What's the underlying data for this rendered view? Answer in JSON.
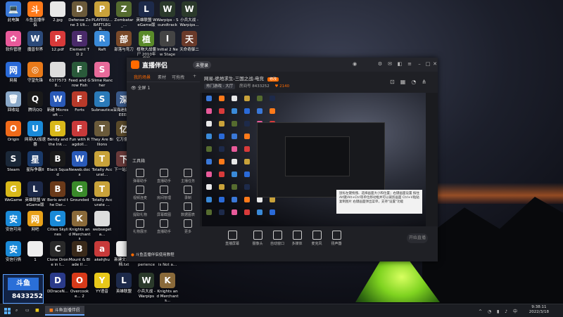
{
  "desktop": {
    "icons": [
      {
        "label": "此电脑",
        "color": "#3a78d8",
        "glyph": "💻"
      },
      {
        "label": "斗鱼直播伴侣",
        "color": "#ff7a1a",
        "glyph": "斗"
      },
      {
        "label": "2.jpg",
        "color": "#e8e8e8",
        "glyph": ""
      },
      {
        "label": "Defense Zone 3 Ult...",
        "color": "#6b5a3a",
        "glyph": "D"
      },
      {
        "label": "PLAYERU... BATTLEGR...",
        "color": "#c9a23a",
        "glyph": "P"
      },
      {
        "label": "Zombatar_...",
        "color": "#556b2f",
        "glyph": "Z"
      },
      {
        "label": "英雄联盟 WeGame版",
        "color": "#1d2a4a",
        "glyph": "L"
      },
      {
        "label": "Warpips - Soundtrack",
        "color": "#2b3a2b",
        "glyph": "W"
      },
      {
        "label": "小兵大战 - Warpips...",
        "color": "#2b3a2b",
        "glyph": "W"
      },
      {
        "label": "软件管理",
        "color": "#e85a9a",
        "glyph": "✿"
      },
      {
        "label": "魔兽世界",
        "color": "#2c4a7a",
        "glyph": "W"
      },
      {
        "label": "12.pdf",
        "color": "#d83a3a",
        "glyph": "P"
      },
      {
        "label": "Element TD 2",
        "color": "#4a2a6a",
        "glyph": "E"
      },
      {
        "label": "Raft",
        "color": "#3a8ad8",
        "glyph": "R"
      },
      {
        "label": "部落与弯刀",
        "color": "#7a4a2a",
        "glyph": "部"
      },
      {
        "label": "植物大战僵尸 2010年度版",
        "color": "#5a8a2a",
        "glyph": "植"
      },
      {
        "label": "Initial 2 New Stage",
        "color": "#444",
        "glyph": "I"
      },
      {
        "label": "天命奇御二",
        "color": "#6a3a2a",
        "glyph": "天"
      },
      {
        "label": "网易",
        "color": "#2a6ad8",
        "glyph": "网"
      },
      {
        "label": "守望先锋",
        "color": "#e87a1a",
        "glyph": "◎"
      },
      {
        "label": "63775738...",
        "color": "#ddd",
        "glyph": ""
      },
      {
        "label": "Feed and Grow Fish",
        "color": "#2a5a3a",
        "glyph": "F"
      },
      {
        "label": "Slime Rancher",
        "color": "#e86a9a",
        "glyph": "S"
      },
      {
        "label": "回收站",
        "color": "#8aa8c8",
        "glyph": "🗑"
      },
      {
        "label": "腾讯QQ",
        "color": "#1a1a1a",
        "glyph": "Q"
      },
      {
        "label": "新建 Microsoft ...",
        "color": "#2a5ab8",
        "glyph": "W"
      },
      {
        "label": "Forts",
        "color": "#b83a2a",
        "glyph": "F"
      },
      {
        "label": "Subnautica",
        "color": "#2a7ab8",
        "glyph": "S"
      },
      {
        "label": "深海迷航 DEEEER",
        "color": "#3a5a8a",
        "glyph": "深"
      },
      {
        "label": "Origin",
        "color": "#f06a1a",
        "glyph": "O"
      },
      {
        "label": "网易UU加速器",
        "color": "#1a8ad8",
        "glyph": "U"
      },
      {
        "label": "Bendy and the Ink ...",
        "color": "#d8b81a",
        "glyph": "B"
      },
      {
        "label": "Fun with Ragdoll...",
        "color": "#c83a3a",
        "glyph": "F"
      },
      {
        "label": "They Are Billions",
        "color": "#6a5a3a",
        "glyph": "T"
      },
      {
        "label": "亿万僵尸",
        "color": "#5a4a2a",
        "glyph": "亿"
      },
      {
        "label": "Steam",
        "color": "#1b2838",
        "glyph": "S"
      },
      {
        "label": "星际争霸II",
        "color": "#1a3a6a",
        "glyph": "星"
      },
      {
        "label": "Black Squad",
        "color": "#1a1a1a",
        "glyph": "B"
      },
      {
        "label": "Neweb.docx",
        "color": "#2a5ab8",
        "glyph": "W"
      },
      {
        "label": "Totally Accurat...",
        "color": "#c8a23a",
        "glyph": "T"
      },
      {
        "label": "下一站江湖",
        "color": "#6a3a3a",
        "glyph": "下"
      },
      {
        "label": "WeGame",
        "color": "#d8b81a",
        "glyph": "G"
      },
      {
        "label": "英雄联盟 WeGame版",
        "color": "#1d2a4a",
        "glyph": "L"
      },
      {
        "label": "Boris and the Dar...",
        "color": "#6a3a1a",
        "glyph": "B"
      },
      {
        "label": "Grounded",
        "color": "#3a8a2a",
        "glyph": "G"
      },
      {
        "label": "Totally Accurate ...",
        "color": "#c8a23a",
        "glyph": "T"
      },
      {
        "label": "安信可用",
        "color": "#1a8ad8",
        "glyph": "安"
      },
      {
        "label": "网吧",
        "color": "#e8a21a",
        "glyph": "网"
      },
      {
        "label": "Cities Skylines",
        "color": "#1a8ad8",
        "glyph": "C"
      },
      {
        "label": "Knights and Merchants",
        "color": "#8a6a3a",
        "glyph": "K"
      },
      {
        "label": "websegeta...",
        "color": "#ddd",
        "glyph": ""
      },
      {
        "label": "安信行情",
        "color": "#1a8ad8",
        "glyph": "安"
      },
      {
        "label": "1",
        "color": "#eee",
        "glyph": ""
      },
      {
        "label": "Clone Drone in t...",
        "color": "#2a2a2a",
        "glyph": "C"
      },
      {
        "label": "Mount & Blade II ...",
        "color": "#3a2a1a",
        "glyph": "B"
      },
      {
        "label": "akehjhu",
        "color": "#c83a3a",
        "glyph": "a"
      },
      {
        "label": "新建文本文档.txt",
        "color": "#eee",
        "glyph": ""
      },
      {
        "label": "GeForce Experience",
        "color": "#76b900",
        "glyph": "G"
      },
      {
        "label": "Diplomacy is Not a...",
        "color": "#3a3a2a",
        "glyph": "D"
      },
      {
        "label": "DDraceN...",
        "color": "#2a3a8a",
        "glyph": "D"
      },
      {
        "label": "Overcooke... 2",
        "color": "#d83a1a",
        "glyph": "O"
      },
      {
        "label": "YY语音",
        "color": "#e8c81a",
        "glyph": "Y"
      },
      {
        "label": "英雄联盟",
        "color": "#1d2a4a",
        "glyph": "L"
      },
      {
        "label": "小兵大战 - Warpips",
        "color": "#2b3a2b",
        "glyph": "W"
      },
      {
        "label": "Knights and Merchants...",
        "color": "#8a6a3a",
        "glyph": "K"
      }
    ],
    "overlay_number": "8433252"
  },
  "app": {
    "name": "直播伴侣",
    "login_label": "未登录",
    "tabs": [
      "我的场景",
      "素材",
      "可拖拽",
      "+"
    ],
    "scene_label": "全屏 1",
    "tools_title": "工具箱",
    "tools": [
      "弹幕助手",
      "直播助手",
      "主播任务",
      "视频连麦",
      "房间管理",
      "录制",
      "提取礼物",
      "屏幕截图",
      "数据图表",
      "礼物展示",
      "直播助手",
      "更多"
    ],
    "gift_link": "斗鱼直播伴侣使用教程",
    "stream_title": "网易-绝地求生-三国之战-电竞",
    "edit_label": "修改",
    "category": "热门游戏 · 大厅",
    "room_id": "房间号 8433252",
    "fans": "♥ 2140",
    "tip_text": "鼠标左键拖拽、选择画面大小和位置；右键画面设置 按住Alt键/Alt+Ctrl等单位移动框并可以裁剪画面 Ctrl+V粘贴复制图片 右键画面弹出菜单，支持\"设置\"功能",
    "bottom_buttons": [
      "直播屏幕",
      "摄像头",
      "自动窗口",
      "多媒体",
      "麦克风",
      "扬声器"
    ],
    "start_label": "开始直播"
  },
  "taskbar": {
    "active_app": "斗鱼直播伴侣",
    "time": "9:38:11",
    "date": "2022/3/18"
  }
}
